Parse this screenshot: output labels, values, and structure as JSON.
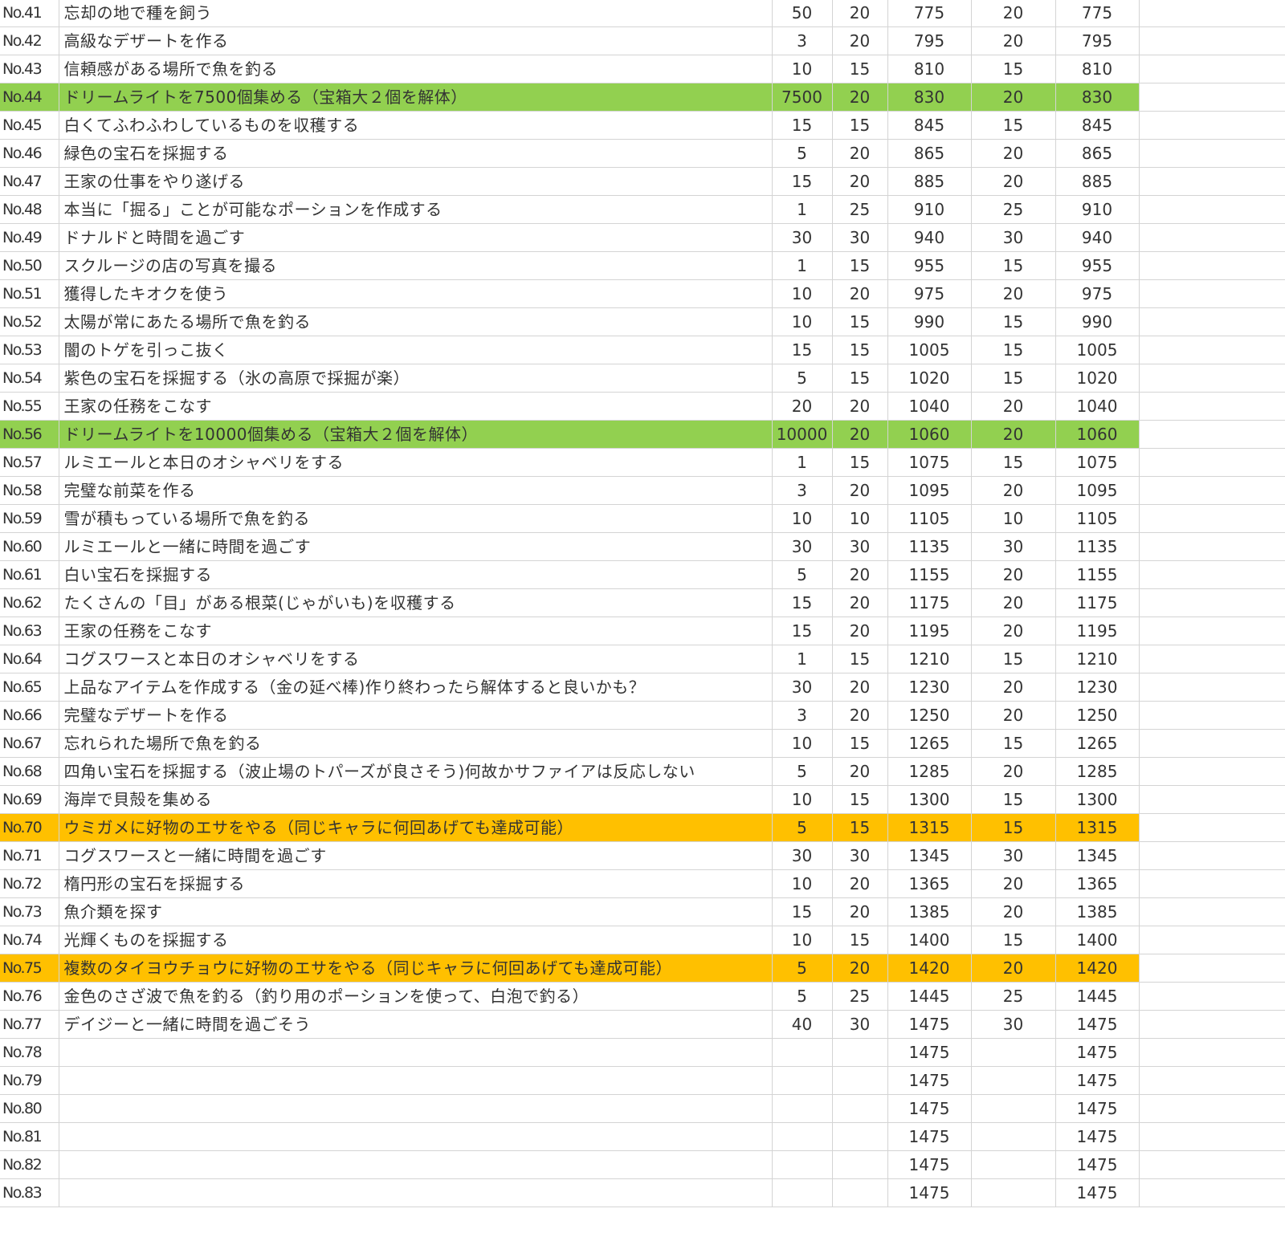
{
  "colors": {
    "green_highlight": "#92d050",
    "orange_highlight": "#ffc000",
    "gridline": "#d4d4d4"
  },
  "rows": [
    {
      "no": "No.41",
      "task": "忘却の地で種を飼う",
      "c1": "50",
      "c2": "20",
      "c3": "775",
      "c4": "20",
      "c5": "775",
      "highlight": ""
    },
    {
      "no": "No.42",
      "task": "高級なデザートを作る",
      "c1": "3",
      "c2": "20",
      "c3": "795",
      "c4": "20",
      "c5": "795",
      "highlight": ""
    },
    {
      "no": "No.43",
      "task": "信頼感がある場所で魚を釣る",
      "c1": "10",
      "c2": "15",
      "c3": "810",
      "c4": "15",
      "c5": "810",
      "highlight": ""
    },
    {
      "no": "No.44",
      "task": "ドリームライトを7500個集める（宝箱大２個を解体）",
      "c1": "7500",
      "c2": "20",
      "c3": "830",
      "c4": "20",
      "c5": "830",
      "highlight": "green"
    },
    {
      "no": "No.45",
      "task": "白くてふわふわしているものを収穫する",
      "c1": "15",
      "c2": "15",
      "c3": "845",
      "c4": "15",
      "c5": "845",
      "highlight": ""
    },
    {
      "no": "No.46",
      "task": "緑色の宝石を採掘する",
      "c1": "5",
      "c2": "20",
      "c3": "865",
      "c4": "20",
      "c5": "865",
      "highlight": ""
    },
    {
      "no": "No.47",
      "task": "王家の仕事をやり遂げる",
      "c1": "15",
      "c2": "20",
      "c3": "885",
      "c4": "20",
      "c5": "885",
      "highlight": ""
    },
    {
      "no": "No.48",
      "task": "本当に「掘る」ことが可能なポーションを作成する",
      "c1": "1",
      "c2": "25",
      "c3": "910",
      "c4": "25",
      "c5": "910",
      "highlight": ""
    },
    {
      "no": "No.49",
      "task": "ドナルドと時間を過ごす",
      "c1": "30",
      "c2": "30",
      "c3": "940",
      "c4": "30",
      "c5": "940",
      "highlight": ""
    },
    {
      "no": "No.50",
      "task": "スクルージの店の写真を撮る",
      "c1": "1",
      "c2": "15",
      "c3": "955",
      "c4": "15",
      "c5": "955",
      "highlight": ""
    },
    {
      "no": "No.51",
      "task": "獲得したキオクを使う",
      "c1": "10",
      "c2": "20",
      "c3": "975",
      "c4": "20",
      "c5": "975",
      "highlight": ""
    },
    {
      "no": "No.52",
      "task": "太陽が常にあたる場所で魚を釣る",
      "c1": "10",
      "c2": "15",
      "c3": "990",
      "c4": "15",
      "c5": "990",
      "highlight": ""
    },
    {
      "no": "No.53",
      "task": "闇のトゲを引っこ抜く",
      "c1": "15",
      "c2": "15",
      "c3": "1005",
      "c4": "15",
      "c5": "1005",
      "highlight": ""
    },
    {
      "no": "No.54",
      "task": "紫色の宝石を採掘する（氷の高原で採掘が楽）",
      "c1": "5",
      "c2": "15",
      "c3": "1020",
      "c4": "15",
      "c5": "1020",
      "highlight": ""
    },
    {
      "no": "No.55",
      "task": "王家の任務をこなす",
      "c1": "20",
      "c2": "20",
      "c3": "1040",
      "c4": "20",
      "c5": "1040",
      "highlight": ""
    },
    {
      "no": "No.56",
      "task": "ドリームライトを10000個集める（宝箱大２個を解体）",
      "c1": "10000",
      "c2": "20",
      "c3": "1060",
      "c4": "20",
      "c5": "1060",
      "highlight": "green"
    },
    {
      "no": "No.57",
      "task": "ルミエールと本日のオシャベリをする",
      "c1": "1",
      "c2": "15",
      "c3": "1075",
      "c4": "15",
      "c5": "1075",
      "highlight": ""
    },
    {
      "no": "No.58",
      "task": "完璧な前菜を作る",
      "c1": "3",
      "c2": "20",
      "c3": "1095",
      "c4": "20",
      "c5": "1095",
      "highlight": ""
    },
    {
      "no": "No.59",
      "task": "雪が積もっている場所で魚を釣る",
      "c1": "10",
      "c2": "10",
      "c3": "1105",
      "c4": "10",
      "c5": "1105",
      "highlight": ""
    },
    {
      "no": "No.60",
      "task": "ルミエールと一緒に時間を過ごす",
      "c1": "30",
      "c2": "30",
      "c3": "1135",
      "c4": "30",
      "c5": "1135",
      "highlight": ""
    },
    {
      "no": "No.61",
      "task": "白い宝石を採掘する",
      "c1": "5",
      "c2": "20",
      "c3": "1155",
      "c4": "20",
      "c5": "1155",
      "highlight": ""
    },
    {
      "no": "No.62",
      "task": "たくさんの「目」がある根菜(じゃがいも)を収穫する",
      "c1": "15",
      "c2": "20",
      "c3": "1175",
      "c4": "20",
      "c5": "1175",
      "highlight": ""
    },
    {
      "no": "No.63",
      "task": "王家の任務をこなす",
      "c1": "15",
      "c2": "20",
      "c3": "1195",
      "c4": "20",
      "c5": "1195",
      "highlight": ""
    },
    {
      "no": "No.64",
      "task": "コグスワースと本日のオシャベリをする",
      "c1": "1",
      "c2": "15",
      "c3": "1210",
      "c4": "15",
      "c5": "1210",
      "highlight": ""
    },
    {
      "no": "No.65",
      "task": "上品なアイテムを作成する（金の延べ棒)作り終わったら解体すると良いかも？",
      "c1": "30",
      "c2": "20",
      "c3": "1230",
      "c4": "20",
      "c5": "1230",
      "highlight": ""
    },
    {
      "no": "No.66",
      "task": "完璧なデザートを作る",
      "c1": "3",
      "c2": "20",
      "c3": "1250",
      "c4": "20",
      "c5": "1250",
      "highlight": ""
    },
    {
      "no": "No.67",
      "task": "忘れられた場所で魚を釣る",
      "c1": "10",
      "c2": "15",
      "c3": "1265",
      "c4": "15",
      "c5": "1265",
      "highlight": ""
    },
    {
      "no": "No.68",
      "task": "四角い宝石を採掘する（波止場のトパーズが良さそう)何故かサファイアは反応しない",
      "c1": "5",
      "c2": "20",
      "c3": "1285",
      "c4": "20",
      "c5": "1285",
      "highlight": ""
    },
    {
      "no": "No.69",
      "task": "海岸で貝殻を集める",
      "c1": "10",
      "c2": "15",
      "c3": "1300",
      "c4": "15",
      "c5": "1300",
      "highlight": ""
    },
    {
      "no": "No.70",
      "task": "ウミガメに好物のエサをやる（同じキャラに何回あげても達成可能）",
      "c1": "5",
      "c2": "15",
      "c3": "1315",
      "c4": "15",
      "c5": "1315",
      "highlight": "orange"
    },
    {
      "no": "No.71",
      "task": "コグスワースと一緒に時間を過ごす",
      "c1": "30",
      "c2": "30",
      "c3": "1345",
      "c4": "30",
      "c5": "1345",
      "highlight": ""
    },
    {
      "no": "No.72",
      "task": "楕円形の宝石を採掘する",
      "c1": "10",
      "c2": "20",
      "c3": "1365",
      "c4": "20",
      "c5": "1365",
      "highlight": ""
    },
    {
      "no": "No.73",
      "task": "魚介類を探す",
      "c1": "15",
      "c2": "20",
      "c3": "1385",
      "c4": "20",
      "c5": "1385",
      "highlight": ""
    },
    {
      "no": "No.74",
      "task": "光輝くものを採掘する",
      "c1": "10",
      "c2": "15",
      "c3": "1400",
      "c4": "15",
      "c5": "1400",
      "highlight": ""
    },
    {
      "no": "No.75",
      "task": "複数のタイヨウチョウに好物のエサをやる（同じキャラに何回あげても達成可能）",
      "c1": "5",
      "c2": "20",
      "c3": "1420",
      "c4": "20",
      "c5": "1420",
      "highlight": "orange"
    },
    {
      "no": "No.76",
      "task": "金色のさざ波で魚を釣る（釣り用のポーションを使って、白泡で釣る）",
      "c1": "5",
      "c2": "25",
      "c3": "1445",
      "c4": "25",
      "c5": "1445",
      "highlight": ""
    },
    {
      "no": "No.77",
      "task": "デイジーと一緒に時間を過ごそう",
      "c1": "40",
      "c2": "30",
      "c3": "1475",
      "c4": "30",
      "c5": "1475",
      "highlight": ""
    },
    {
      "no": "No.78",
      "task": "",
      "c1": "",
      "c2": "",
      "c3": "1475",
      "c4": "",
      "c5": "1475",
      "highlight": ""
    },
    {
      "no": "No.79",
      "task": "",
      "c1": "",
      "c2": "",
      "c3": "1475",
      "c4": "",
      "c5": "1475",
      "highlight": ""
    },
    {
      "no": "No.80",
      "task": "",
      "c1": "",
      "c2": "",
      "c3": "1475",
      "c4": "",
      "c5": "1475",
      "highlight": ""
    },
    {
      "no": "No.81",
      "task": "",
      "c1": "",
      "c2": "",
      "c3": "1475",
      "c4": "",
      "c5": "1475",
      "highlight": ""
    },
    {
      "no": "No.82",
      "task": "",
      "c1": "",
      "c2": "",
      "c3": "1475",
      "c4": "",
      "c5": "1475",
      "highlight": ""
    },
    {
      "no": "No.83",
      "task": "",
      "c1": "",
      "c2": "",
      "c3": "1475",
      "c4": "",
      "c5": "1475",
      "highlight": ""
    }
  ]
}
